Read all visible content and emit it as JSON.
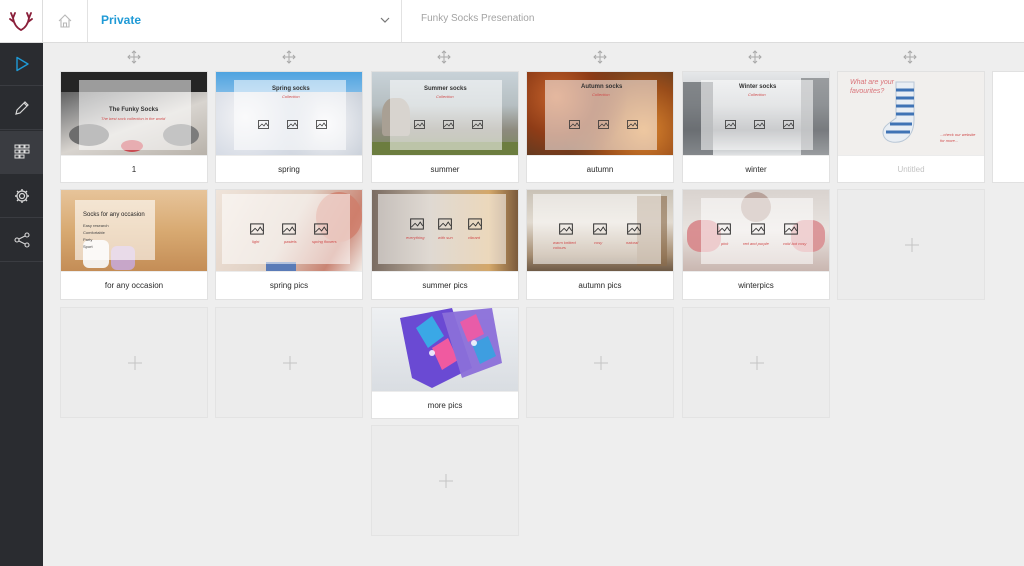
{
  "topbar": {
    "folder_name": "Private",
    "presentation_title": "Funky Socks Presenation"
  },
  "sidebar": {
    "items": [
      "play-icon",
      "pencil-icon",
      "grid-icon",
      "gear-icon",
      "share-icon"
    ],
    "active": "grid-icon"
  },
  "colors": {
    "accent": "#1f9ad6",
    "sidebar_bg": "#2a2c30",
    "logo": "#8a1f3a"
  },
  "slides": {
    "row1": [
      {
        "label": "1",
        "overlay_title": "The Funky Socks",
        "overlay_sub": "The best sock collection in the world"
      },
      {
        "label": "spring",
        "overlay_title": "Spring socks",
        "overlay_sub": "Collection"
      },
      {
        "label": "summer",
        "overlay_title": "Summer socks",
        "overlay_sub": "Collection"
      },
      {
        "label": "autumn",
        "overlay_title": "Autumn socks",
        "overlay_sub": "Collection"
      },
      {
        "label": "winter",
        "overlay_title": "Winter socks",
        "overlay_sub": "Collection"
      },
      {
        "label": "Untitled",
        "overlay_title": "What are your favourites?",
        "overlay_sub": "...check our website for more..."
      }
    ],
    "row2": [
      {
        "label": "for any occasion",
        "overlay_title": "Socks for any occasion",
        "lines": [
          "Easy research",
          "Comfortable",
          "Party",
          "Sport"
        ]
      },
      {
        "label": "spring pics",
        "captions": [
          "light",
          "pastels",
          "spring flowers"
        ]
      },
      {
        "label": "summer pics",
        "captions": [
          "everything",
          "with sun",
          "vibrant"
        ]
      },
      {
        "label": "autumn pics",
        "captions": [
          "warm knitted colours",
          "cosy",
          "natural"
        ]
      },
      {
        "label": "winterpics",
        "captions": [
          "pink",
          "red and purple",
          "cold but cosy"
        ]
      }
    ],
    "row3": [
      {
        "label": "more pics"
      }
    ]
  }
}
